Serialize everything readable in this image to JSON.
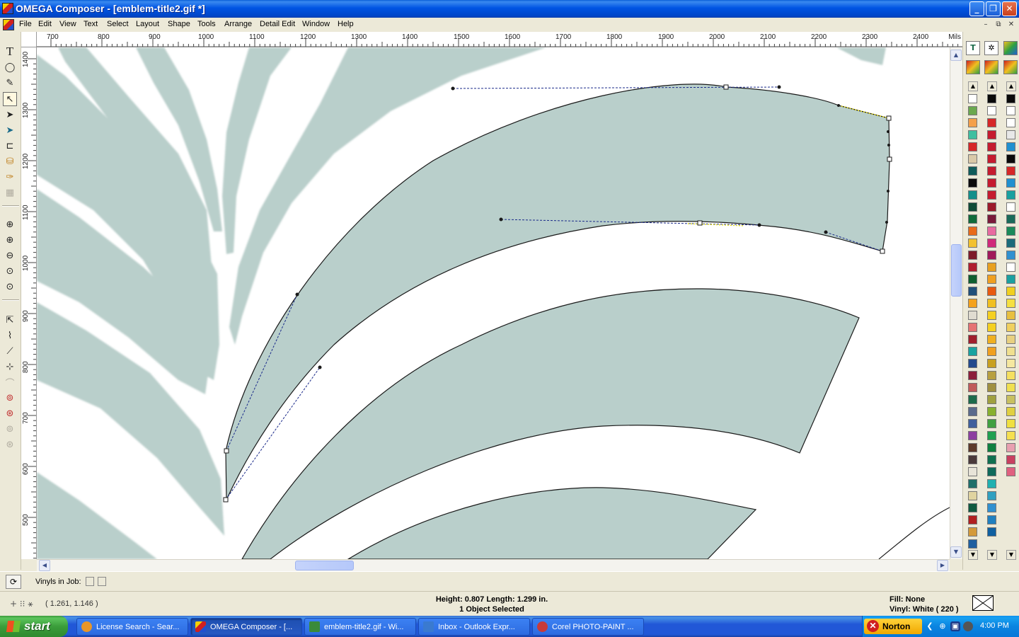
{
  "window": {
    "title": "OMEGA Composer - [emblem-title2.gif *]",
    "buttons": [
      "_",
      "❐",
      "✕"
    ]
  },
  "menubar": {
    "items": [
      "File",
      "Edit",
      "View",
      "Text",
      "Select",
      "Layout",
      "Shape",
      "Tools",
      "Arrange",
      "Detail Edit",
      "Window",
      "Help"
    ],
    "mdi_buttons": [
      "–",
      "⧉",
      "✕"
    ]
  },
  "ruler": {
    "units": "Mils",
    "horizontal_ticks": [
      "700",
      "800",
      "900",
      "1000",
      "1100",
      "1200",
      "1300",
      "1400",
      "1500",
      "1600",
      "1700",
      "1800",
      "1900",
      "2000",
      "2100",
      "2200",
      "2300",
      "2400"
    ],
    "vertical_ticks": [
      "1400",
      "1300",
      "1200",
      "1100",
      "1000",
      "900",
      "800",
      "700",
      "600",
      "500"
    ]
  },
  "toolbox": {
    "tools": [
      "text-tool-icon",
      "ellipse-tool-icon",
      "pen-tool-icon",
      "node-edit-tool-icon",
      "select-arrow-icon",
      "shape-select-icon",
      "ruler-tool-icon",
      "fill-bucket-icon",
      "eyedropper-icon",
      "grid-tool-icon",
      "zoom-in-icon",
      "zoom-select-icon",
      "zoom-out-icon",
      "zoom-fit-icon",
      "zoom-page-icon",
      "node-select-icon",
      "node-add-icon",
      "node-delete-icon",
      "node-break-icon",
      "node-join-icon",
      "weld-icon",
      "contour-icon",
      "offset-icon",
      "outline-icon"
    ]
  },
  "palette": {
    "colors_col1": [
      "#ffffff",
      "#6aa84f",
      "#f4a04b",
      "#3fbfa0",
      "#d62728",
      "#d9c9a8",
      "#0f5c5a",
      "#0b0b0b",
      "#138f8a",
      "#0f4b36",
      "#0f6b3a",
      "#e86a1a",
      "#f2c12e",
      "#7d1b2a",
      "#b01e2e",
      "#0e5e2f",
      "#1f4f7a",
      "#f4a21b",
      "#e0dcd0",
      "#e57373",
      "#a01f2c",
      "#19a3a0",
      "#244a8c",
      "#8c1f3a",
      "#c05a5a",
      "#1c6b4a",
      "#5a6b8c",
      "#3f5f9c",
      "#8c3fa0",
      "#5c3a2a",
      "#4a3a3a",
      "#e8e4d8",
      "#1f6f6a",
      "#e0d4a0",
      "#0f5a40",
      "#b02020",
      "#d49a3a",
      "#1f5fa0"
    ],
    "colors_col2": [
      "#0a0a0a",
      "#ffffff",
      "#d62728",
      "#c51b2f",
      "#c51b2f",
      "#c51b2f",
      "#c51b2f",
      "#c51b2f",
      "#c51b2f",
      "#9c1a2a",
      "#7a1a3a",
      "#e86aa0",
      "#d02a7a",
      "#a01a5a",
      "#e8a020",
      "#f0a020",
      "#e85a10",
      "#f0c020",
      "#f5d020",
      "#f5d020",
      "#f0b020",
      "#f0a020",
      "#c8a020",
      "#b8a040",
      "#a09040",
      "#a0a040",
      "#88b030",
      "#40a040",
      "#20a050",
      "#108040",
      "#107050",
      "#0f6a5a",
      "#20b0b0",
      "#30a0c0",
      "#3090d0",
      "#2080c0",
      "#1060a0"
    ],
    "colors_col3": [
      "#0a0a0a",
      "#ffffff",
      "#ffffff",
      "#e8e8e8",
      "#2090d0",
      "#0a0a0a",
      "#d62728",
      "#2090d0",
      "#1aa0a0",
      "#ffffff",
      "#1a6b5a",
      "#1a8a5a",
      "#1a6b7a",
      "#3090d0",
      "#ffffff",
      "#1aa0a0",
      "#f0d020",
      "#f5e040",
      "#e8c040",
      "#f0d060",
      "#e8d080",
      "#f0e090",
      "#f5e8a0",
      "#f5e060",
      "#f0e050",
      "#c8c060",
      "#e0d040",
      "#f0e040",
      "#f5e050",
      "#e8a0b0",
      "#c84060",
      "#e06080"
    ],
    "icons": [
      "text-color-icon",
      "outline-icon",
      "color-wheel-icon",
      "palette-a-icon",
      "palette-b-icon",
      "palette-c-icon"
    ]
  },
  "vinyl_bar": {
    "label": "Vinyls in Job:"
  },
  "statusbar": {
    "coords": "( 1.261, 1.146 )",
    "line1": "Height: 0.807  Length: 1.299  in.",
    "line2": "1 Object Selected",
    "fill": "Fill: None",
    "vinyl": "Vinyl: White  ( 220 )"
  },
  "taskbar": {
    "start_label": "start",
    "tasks": [
      {
        "label": "License Search - Sear...",
        "icon_color": "#e8962a"
      },
      {
        "label": "OMEGA Composer - [...",
        "icon_color": "#d8c020"
      },
      {
        "label": "emblem-title2.gif - Wi...",
        "icon_color": "#3a8a3a"
      },
      {
        "label": "Inbox - Outlook Expr...",
        "icon_color": "#3a7ad0"
      },
      {
        "label": "Corel PHOTO-PAINT ...",
        "icon_color": "#c83a3a"
      }
    ],
    "norton_label": "Norton",
    "clock": "4:00 PM"
  },
  "colors": {
    "shape_fill": "#b9cfcb",
    "canvas_bg": "#ffffff",
    "handle_line": "#1a2a8a",
    "title_blue": "#0054e3"
  }
}
